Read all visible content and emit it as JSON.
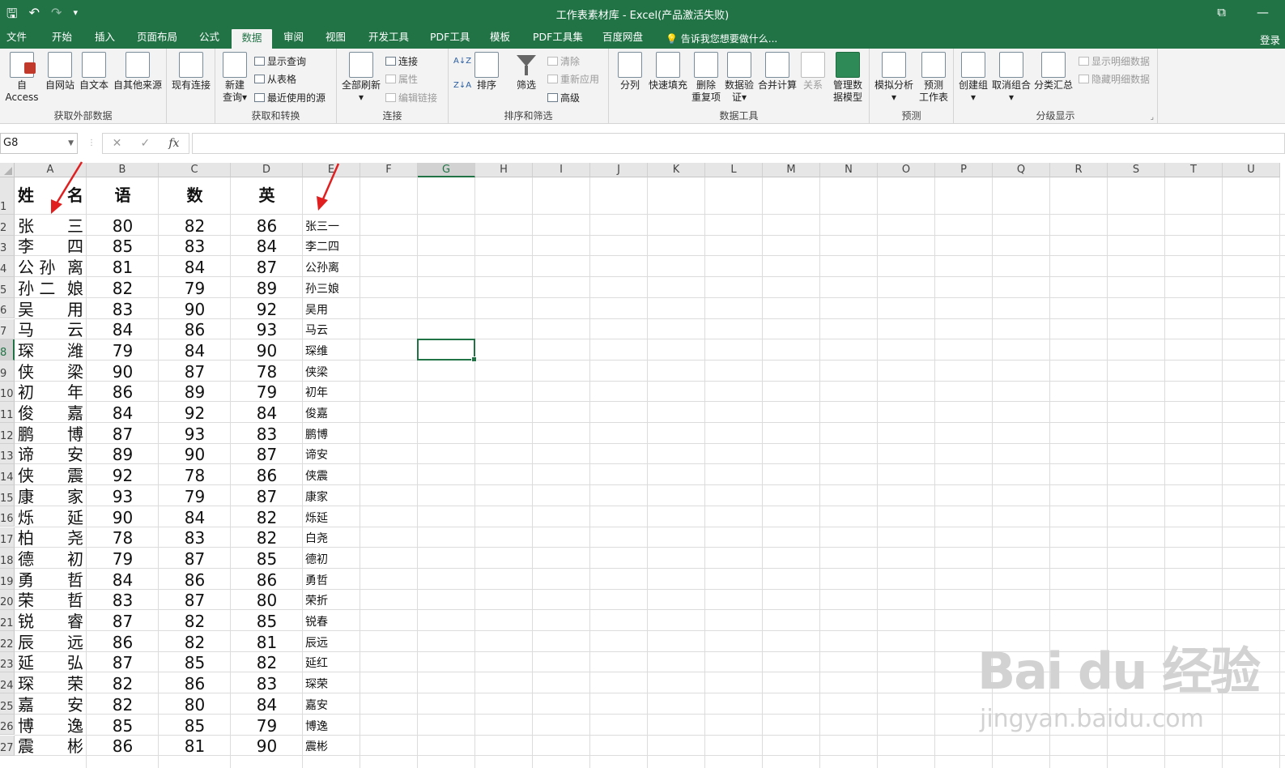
{
  "window": {
    "title": "工作表素材库 - Excel(产品激活失败)",
    "qat": {
      "save": "🖫",
      "undo": "↶",
      "redo": "↷",
      "customize": "▾"
    },
    "controls": {
      "restore": "⧉",
      "minimize": "—"
    }
  },
  "tabs": [
    "文件",
    "开始",
    "插入",
    "页面布局",
    "公式",
    "数据",
    "审阅",
    "视图",
    "开发工具",
    "PDF工具",
    "模板",
    "PDF工具集",
    "百度网盘"
  ],
  "active_tab": "数据",
  "tell_me": "告诉我您想要做什么...",
  "login": "登录",
  "ribbon": {
    "groups": {
      "external": "获取外部数据",
      "transform": "获取和转换",
      "connections": "连接",
      "sortfilter": "排序和筛选",
      "datatools": "数据工具",
      "forecast": "预测",
      "outline": "分级显示"
    },
    "buttons": {
      "access": "自 Access",
      "web": "自网站",
      "text": "自文本",
      "other": "自其他来源",
      "existing": "现有连接",
      "newquery_1": "新建",
      "newquery_2": "查询",
      "showquery": "显示查询",
      "fromtable": "从表格",
      "recent": "最近使用的源",
      "refreshall": "全部刷新",
      "connections": "连接",
      "properties": "属性",
      "editlinks": "编辑链接",
      "sortaz": "A↓Z",
      "sortza": "Z↓A",
      "sort": "排序",
      "filter": "筛选",
      "clear": "清除",
      "reapply": "重新应用",
      "advanced": "高级",
      "split": "分列",
      "flashfill": "快速填充",
      "removedup_1": "删除",
      "removedup_2": "重复项",
      "validation_1": "数据验",
      "validation_2": "证",
      "consolidate": "合并计算",
      "relations": "关系",
      "datamodel_1": "管理数",
      "datamodel_2": "据模型",
      "whatif": "模拟分析",
      "forecastsheet_1": "预测",
      "forecastsheet_2": "工作表",
      "group": "创建组",
      "ungroup": "取消组合",
      "subtotal": "分类汇总",
      "showdetail": "显示明细数据",
      "hidedetail": "隐藏明细数据"
    }
  },
  "formula_bar": {
    "name_box": "G8",
    "cancel": "✕",
    "enter": "✓",
    "fx": "fx",
    "value": ""
  },
  "columns": [
    "A",
    "B",
    "C",
    "D",
    "E",
    "F",
    "G",
    "H",
    "I",
    "J",
    "K",
    "L",
    "M",
    "N",
    "O",
    "P",
    "Q",
    "R",
    "S",
    "T",
    "U"
  ],
  "selected_cell": {
    "column": "G",
    "row": 8
  },
  "header_row": {
    "a1": "姓",
    "a2": "名",
    "b": "语",
    "c": "数",
    "d": "英"
  },
  "rows": [
    {
      "n": "1",
      "sur": "",
      "giv": "",
      "b": "",
      "c": "",
      "d": "",
      "e": ""
    },
    {
      "n": "2",
      "sur": "张",
      "giv": "三",
      "b": "80",
      "c": "82",
      "d": "86",
      "e": "张三一"
    },
    {
      "n": "3",
      "sur": "李",
      "giv": "四",
      "b": "85",
      "c": "83",
      "d": "84",
      "e": "李二四"
    },
    {
      "n": "4",
      "sur": "公 孙",
      "giv": "离",
      "b": "81",
      "c": "84",
      "d": "87",
      "e": "公孙离"
    },
    {
      "n": "5",
      "sur": "孙 二",
      "giv": "娘",
      "b": "82",
      "c": "79",
      "d": "89",
      "e": "孙三娘"
    },
    {
      "n": "6",
      "sur": "吴",
      "giv": "用",
      "b": "83",
      "c": "90",
      "d": "92",
      "e": "吴用"
    },
    {
      "n": "7",
      "sur": "马",
      "giv": "云",
      "b": "84",
      "c": "86",
      "d": "93",
      "e": "马云"
    },
    {
      "n": "8",
      "sur": "琛",
      "giv": "潍",
      "b": "79",
      "c": "84",
      "d": "90",
      "e": "琛维"
    },
    {
      "n": "9",
      "sur": "侠",
      "giv": "梁",
      "b": "90",
      "c": "87",
      "d": "78",
      "e": "侠梁"
    },
    {
      "n": "10",
      "sur": "初",
      "giv": "年",
      "b": "86",
      "c": "89",
      "d": "79",
      "e": "初年"
    },
    {
      "n": "11",
      "sur": "俊",
      "giv": "嘉",
      "b": "84",
      "c": "92",
      "d": "84",
      "e": "俊嘉"
    },
    {
      "n": "12",
      "sur": "鹏",
      "giv": "博",
      "b": "87",
      "c": "93",
      "d": "83",
      "e": "鹏博"
    },
    {
      "n": "13",
      "sur": "谛",
      "giv": "安",
      "b": "89",
      "c": "90",
      "d": "87",
      "e": "谛安"
    },
    {
      "n": "14",
      "sur": "侠",
      "giv": "震",
      "b": "92",
      "c": "78",
      "d": "86",
      "e": "侠震"
    },
    {
      "n": "15",
      "sur": "康",
      "giv": "家",
      "b": "93",
      "c": "79",
      "d": "87",
      "e": "康家"
    },
    {
      "n": "16",
      "sur": "烁",
      "giv": "延",
      "b": "90",
      "c": "84",
      "d": "82",
      "e": "烁延"
    },
    {
      "n": "17",
      "sur": "柏",
      "giv": "尧",
      "b": "78",
      "c": "83",
      "d": "82",
      "e": "白尧"
    },
    {
      "n": "18",
      "sur": "德",
      "giv": "初",
      "b": "79",
      "c": "87",
      "d": "85",
      "e": "德初"
    },
    {
      "n": "19",
      "sur": "勇",
      "giv": "哲",
      "b": "84",
      "c": "86",
      "d": "86",
      "e": "勇哲"
    },
    {
      "n": "20",
      "sur": "荣",
      "giv": "哲",
      "b": "83",
      "c": "87",
      "d": "80",
      "e": "荣折"
    },
    {
      "n": "21",
      "sur": "锐",
      "giv": "睿",
      "b": "87",
      "c": "82",
      "d": "85",
      "e": "锐春"
    },
    {
      "n": "22",
      "sur": "辰",
      "giv": "远",
      "b": "86",
      "c": "82",
      "d": "81",
      "e": "辰远"
    },
    {
      "n": "23",
      "sur": "延",
      "giv": "弘",
      "b": "87",
      "c": "85",
      "d": "82",
      "e": "延红"
    },
    {
      "n": "24",
      "sur": "琛",
      "giv": "荣",
      "b": "82",
      "c": "86",
      "d": "83",
      "e": "琛荣"
    },
    {
      "n": "25",
      "sur": "嘉",
      "giv": "安",
      "b": "82",
      "c": "80",
      "d": "84",
      "e": "嘉安"
    },
    {
      "n": "26",
      "sur": "博",
      "giv": "逸",
      "b": "85",
      "c": "85",
      "d": "79",
      "e": "博逸"
    },
    {
      "n": "27",
      "sur": "震",
      "giv": "彬",
      "b": "86",
      "c": "81",
      "d": "90",
      "e": "震彬"
    }
  ],
  "watermark": {
    "logo": "Bai du 经验",
    "url": "jingyan.baidu.com"
  }
}
